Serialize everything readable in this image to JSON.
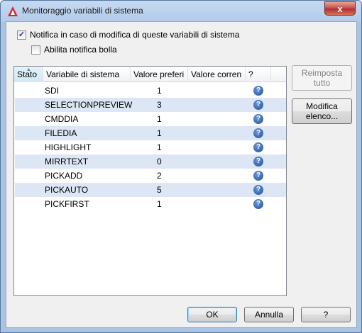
{
  "window": {
    "title": "Monitoraggio variabili di sistema",
    "close_glyph": "x",
    "app_icon": "autocad-icon"
  },
  "options": {
    "notify_label": "Notifica in caso di modifica di queste variabili di sistema",
    "notify_checked": true,
    "balloon_label": "Abilita notifica bolla",
    "balloon_checked": false
  },
  "table": {
    "columns": [
      "Stato",
      "Variabile di sistema",
      "Valore preferi",
      "Valore corren",
      "?"
    ],
    "help_icon": "help-icon",
    "rows": [
      {
        "name": "SDI",
        "preferred": "1",
        "current": ""
      },
      {
        "name": "SELECTIONPREVIEW",
        "preferred": "3",
        "current": ""
      },
      {
        "name": "CMDDIA",
        "preferred": "1",
        "current": ""
      },
      {
        "name": "FILEDIA",
        "preferred": "1",
        "current": ""
      },
      {
        "name": "HIGHLIGHT",
        "preferred": "1",
        "current": ""
      },
      {
        "name": "MIRRTEXT",
        "preferred": "0",
        "current": ""
      },
      {
        "name": "PICKADD",
        "preferred": "2",
        "current": ""
      },
      {
        "name": "PICKAUTO",
        "preferred": "5",
        "current": ""
      },
      {
        "name": "PICKFIRST",
        "preferred": "1",
        "current": ""
      }
    ]
  },
  "side_buttons": {
    "reset_line1": "Reimposta",
    "reset_line2": "tutto",
    "edit_line1": "Modifica",
    "edit_line2": "elenco..."
  },
  "footer": {
    "ok": "OK",
    "cancel": "Annulla",
    "help": "?"
  },
  "colors": {
    "row_alt": "#dde6f4",
    "help_icon": "#1f4f9e",
    "close_button": "#c75050"
  }
}
